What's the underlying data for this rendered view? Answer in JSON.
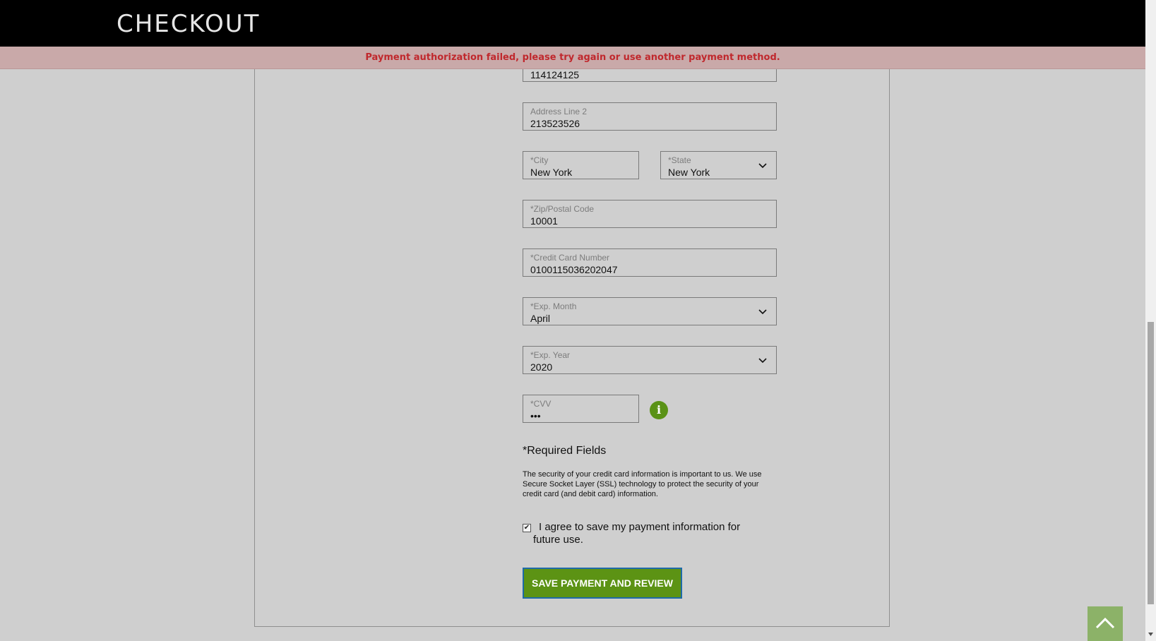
{
  "header": {
    "title": "CHECKOUT"
  },
  "alert": {
    "message": "Payment authorization failed, please try again or use another payment method."
  },
  "form": {
    "address_line1": {
      "value": "114124125"
    },
    "address_line2": {
      "label": "Address Line 2",
      "value": "213523526"
    },
    "city": {
      "label": "*City",
      "value": "New York"
    },
    "state": {
      "label": "*State",
      "value": "New York"
    },
    "zip": {
      "label": "*Zip/Postal Code",
      "value": "10001"
    },
    "card_number": {
      "label": "*Credit Card Number",
      "value": "0100115036202047"
    },
    "exp_month": {
      "label": "*Exp. Month",
      "value": "April"
    },
    "exp_year": {
      "label": "*Exp. Year",
      "value": "2020"
    },
    "cvv": {
      "label": "*CVV",
      "value": "•••"
    },
    "info_icon": "i",
    "required_note": "*Required Fields",
    "security_text": "The security of your credit card information is important to us. We use Secure Socket Layer (SSL) technology to protect the security of your credit card (and debit card) information.",
    "agree_checked": true,
    "agree_label": "I agree to save my payment information for future use.",
    "submit_label": "SAVE PAYMENT AND REVIEW"
  },
  "icons": {
    "chevron": "chevron-down-icon",
    "info": "info-icon",
    "scroll_top": "chevron-up-icon"
  },
  "colors": {
    "accent_green": "#5c9314",
    "error_red": "#c0282d",
    "alert_bg": "#c9a9a9",
    "header_bg": "#000000"
  }
}
